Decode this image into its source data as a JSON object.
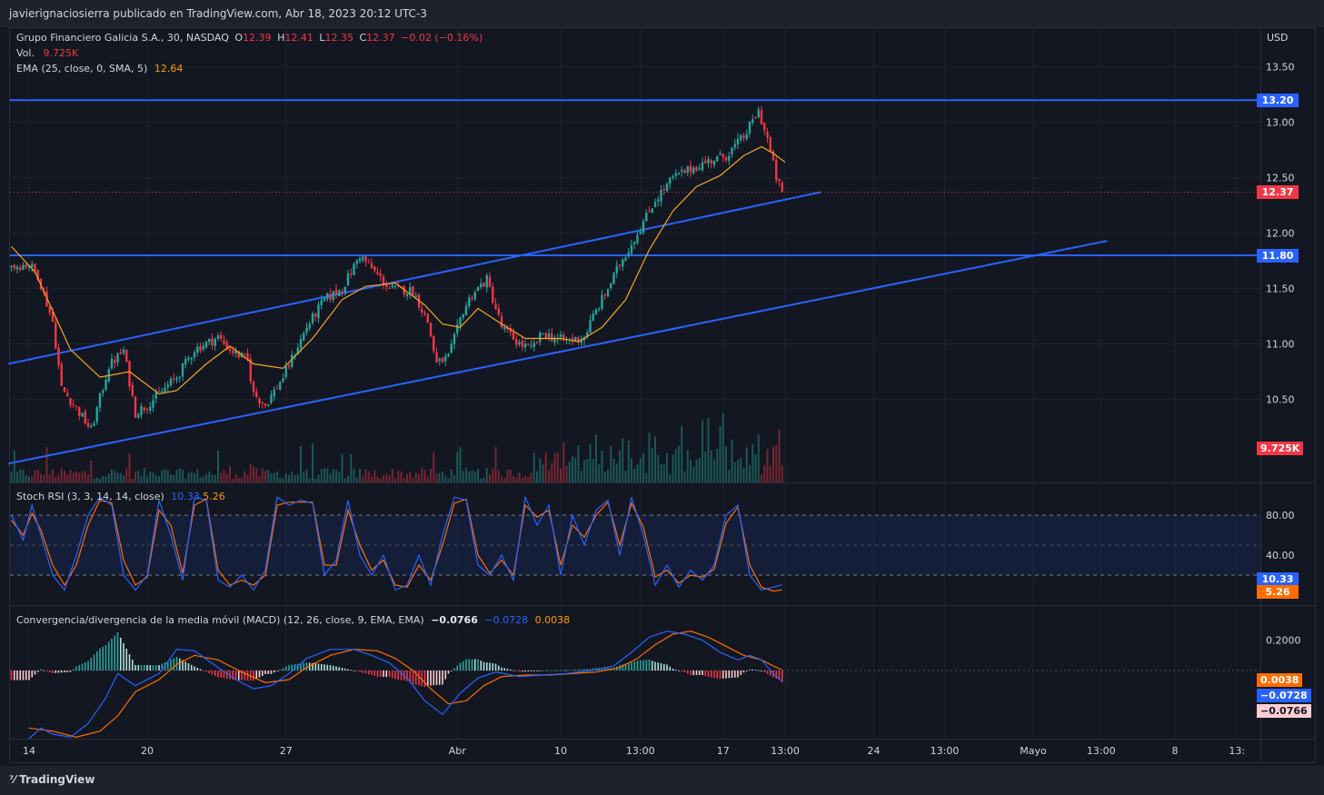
{
  "header": {
    "publisher": "javierignaciosierra publicado en TradingView.com, Abr 18, 2023 20:12 UTC-3"
  },
  "footer": {
    "logo": "TradingView"
  },
  "legend": {
    "symbol": "Grupo Financiero Galicia S.A., 30, NASDAQ",
    "o_label": "O",
    "o": "12.39",
    "h_label": "H",
    "h": "12.41",
    "l_label": "L",
    "l": "12.35",
    "c_label": "C",
    "c": "12.37",
    "change": "−0.02 (−0.16%)",
    "vol_label": "Vol.",
    "vol": "9.725K",
    "ema_label": "EMA (25, close, 0, SMA, 5)",
    "ema": "12.64",
    "stoch_label": "Stoch RSI (3, 3, 14, 14, close)",
    "stoch_k": "10.33",
    "stoch_d": "5.26",
    "macd_label": "Convergencia/divergencia de la media móvil (MACD) (12, 26, close, 9, EMA, EMA)",
    "macd_hist": "−0.0766",
    "macd": "−0.0728",
    "macd_signal": "0.0038"
  },
  "chart_data": {
    "type": "candlestick",
    "currency": "USD",
    "price_ticks": [
      "13.50",
      "13.00",
      "12.50",
      "12.00",
      "11.50",
      "11.00",
      "10.50"
    ],
    "price_tick_values": [
      13.5,
      13.0,
      12.5,
      12.0,
      11.5,
      11.0,
      10.5
    ],
    "price_range": [
      9.75,
      13.85
    ],
    "x_ticks": [
      "14",
      "20",
      "27",
      "Abr",
      "10",
      "13:00",
      "17",
      "13:00",
      "24",
      "13:00",
      "Mayo",
      "13:00",
      "8",
      "13:"
    ],
    "x_tick_slots": [
      6,
      46,
      93,
      151,
      186,
      213,
      241,
      262,
      292,
      316,
      346,
      369,
      394,
      415
    ],
    "last_slot": 261,
    "horizontal_levels": [
      {
        "value": 13.2,
        "label": "13.20"
      },
      {
        "value": 11.8,
        "label": "11.80"
      }
    ],
    "trendlines": [
      {
        "from": [
          -1,
          10.82
        ],
        "to": [
          274,
          12.37
        ]
      },
      {
        "from": [
          -1,
          9.92
        ],
        "to": [
          371,
          11.93
        ]
      }
    ],
    "last_price": {
      "value": 12.37,
      "label": "12.37"
    },
    "volume_badge": "9.725K",
    "price_path": [
      [
        0,
        11.7
      ],
      [
        6,
        11.72
      ],
      [
        9,
        11.62
      ],
      [
        14,
        11.2
      ],
      [
        17,
        10.6
      ],
      [
        22,
        10.42
      ],
      [
        27,
        10.22
      ],
      [
        33,
        10.8
      ],
      [
        38,
        10.94
      ],
      [
        42,
        10.38
      ],
      [
        46,
        10.45
      ],
      [
        50,
        10.55
      ],
      [
        56,
        10.7
      ],
      [
        62,
        10.95
      ],
      [
        70,
        11.06
      ],
      [
        74,
        10.95
      ],
      [
        80,
        10.85
      ],
      [
        82,
        10.55
      ],
      [
        86,
        10.45
      ],
      [
        92,
        10.7
      ],
      [
        100,
        11.15
      ],
      [
        106,
        11.4
      ],
      [
        112,
        11.5
      ],
      [
        118,
        11.8
      ],
      [
        124,
        11.62
      ],
      [
        128,
        11.5
      ],
      [
        136,
        11.48
      ],
      [
        141,
        11.2
      ],
      [
        144,
        10.82
      ],
      [
        148,
        10.88
      ],
      [
        153,
        11.3
      ],
      [
        156,
        11.45
      ],
      [
        161,
        11.58
      ],
      [
        166,
        11.15
      ],
      [
        172,
        11.0
      ],
      [
        176,
        10.95
      ],
      [
        180,
        11.1
      ],
      [
        184,
        11.05
      ],
      [
        188,
        11.03
      ],
      [
        194,
        11.06
      ],
      [
        197,
        11.25
      ],
      [
        202,
        11.5
      ],
      [
        206,
        11.72
      ],
      [
        212,
        12.0
      ],
      [
        218,
        12.3
      ],
      [
        224,
        12.5
      ],
      [
        230,
        12.58
      ],
      [
        236,
        12.65
      ],
      [
        242,
        12.7
      ],
      [
        248,
        12.87
      ],
      [
        253,
        13.1
      ],
      [
        256,
        12.85
      ],
      [
        259,
        12.5
      ],
      [
        261,
        12.37
      ]
    ],
    "ema_path": [
      [
        0,
        11.88
      ],
      [
        8,
        11.65
      ],
      [
        20,
        10.95
      ],
      [
        30,
        10.7
      ],
      [
        40,
        10.75
      ],
      [
        50,
        10.55
      ],
      [
        56,
        10.58
      ],
      [
        66,
        10.82
      ],
      [
        74,
        10.98
      ],
      [
        82,
        10.82
      ],
      [
        92,
        10.78
      ],
      [
        102,
        11.05
      ],
      [
        112,
        11.4
      ],
      [
        120,
        11.52
      ],
      [
        130,
        11.55
      ],
      [
        140,
        11.35
      ],
      [
        146,
        11.18
      ],
      [
        152,
        11.15
      ],
      [
        158,
        11.32
      ],
      [
        166,
        11.18
      ],
      [
        174,
        11.05
      ],
      [
        186,
        11.05
      ],
      [
        192,
        11.02
      ],
      [
        200,
        11.15
      ],
      [
        208,
        11.4
      ],
      [
        216,
        11.85
      ],
      [
        224,
        12.2
      ],
      [
        232,
        12.42
      ],
      [
        240,
        12.52
      ],
      [
        248,
        12.7
      ],
      [
        254,
        12.78
      ],
      [
        258,
        12.72
      ],
      [
        262,
        12.64
      ]
    ],
    "stoch_rsi": {
      "range": [
        0,
        100
      ],
      "ticks": [
        "80.00",
        "40.00"
      ],
      "tick_values": [
        80,
        40
      ],
      "bands": [
        80,
        50,
        20
      ],
      "k_last": 10.33,
      "d_last": 5.26,
      "k_path": [
        [
          0,
          80
        ],
        [
          4,
          55
        ],
        [
          7,
          90
        ],
        [
          10,
          60
        ],
        [
          14,
          20
        ],
        [
          18,
          5
        ],
        [
          22,
          40
        ],
        [
          26,
          80
        ],
        [
          30,
          98
        ],
        [
          34,
          90
        ],
        [
          38,
          20
        ],
        [
          42,
          5
        ],
        [
          46,
          20
        ],
        [
          50,
          95
        ],
        [
          54,
          60
        ],
        [
          58,
          15
        ],
        [
          62,
          98
        ],
        [
          66,
          95
        ],
        [
          70,
          15
        ],
        [
          74,
          8
        ],
        [
          78,
          20
        ],
        [
          82,
          5
        ],
        [
          86,
          25
        ],
        [
          90,
          98
        ],
        [
          94,
          90
        ],
        [
          98,
          95
        ],
        [
          102,
          92
        ],
        [
          106,
          20
        ],
        [
          110,
          35
        ],
        [
          114,
          95
        ],
        [
          118,
          40
        ],
        [
          122,
          20
        ],
        [
          126,
          40
        ],
        [
          130,
          5
        ],
        [
          134,
          10
        ],
        [
          138,
          40
        ],
        [
          142,
          10
        ],
        [
          146,
          60
        ],
        [
          150,
          98
        ],
        [
          154,
          95
        ],
        [
          158,
          30
        ],
        [
          162,
          20
        ],
        [
          166,
          40
        ],
        [
          170,
          15
        ],
        [
          174,
          98
        ],
        [
          178,
          70
        ],
        [
          182,
          90
        ],
        [
          186,
          20
        ],
        [
          190,
          80
        ],
        [
          194,
          50
        ],
        [
          198,
          85
        ],
        [
          202,
          95
        ],
        [
          206,
          40
        ],
        [
          210,
          98
        ],
        [
          214,
          60
        ],
        [
          218,
          10
        ],
        [
          222,
          30
        ],
        [
          226,
          8
        ],
        [
          230,
          25
        ],
        [
          234,
          15
        ],
        [
          238,
          30
        ],
        [
          242,
          80
        ],
        [
          246,
          90
        ],
        [
          250,
          20
        ],
        [
          254,
          5
        ],
        [
          258,
          8
        ],
        [
          261,
          10.33
        ]
      ],
      "d_path": [
        [
          0,
          75
        ],
        [
          4,
          60
        ],
        [
          7,
          82
        ],
        [
          10,
          65
        ],
        [
          14,
          30
        ],
        [
          18,
          10
        ],
        [
          22,
          30
        ],
        [
          26,
          70
        ],
        [
          30,
          95
        ],
        [
          34,
          92
        ],
        [
          38,
          35
        ],
        [
          42,
          10
        ],
        [
          46,
          18
        ],
        [
          50,
          85
        ],
        [
          54,
          70
        ],
        [
          58,
          22
        ],
        [
          62,
          90
        ],
        [
          66,
          96
        ],
        [
          70,
          25
        ],
        [
          74,
          10
        ],
        [
          78,
          15
        ],
        [
          82,
          10
        ],
        [
          86,
          20
        ],
        [
          90,
          90
        ],
        [
          94,
          93
        ],
        [
          98,
          93
        ],
        [
          102,
          93
        ],
        [
          106,
          30
        ],
        [
          110,
          30
        ],
        [
          114,
          85
        ],
        [
          118,
          50
        ],
        [
          122,
          25
        ],
        [
          126,
          35
        ],
        [
          130,
          10
        ],
        [
          134,
          8
        ],
        [
          138,
          30
        ],
        [
          142,
          15
        ],
        [
          146,
          50
        ],
        [
          150,
          92
        ],
        [
          154,
          96
        ],
        [
          158,
          40
        ],
        [
          162,
          22
        ],
        [
          166,
          35
        ],
        [
          170,
          20
        ],
        [
          174,
          90
        ],
        [
          178,
          78
        ],
        [
          182,
          85
        ],
        [
          186,
          30
        ],
        [
          190,
          70
        ],
        [
          194,
          58
        ],
        [
          198,
          80
        ],
        [
          202,
          93
        ],
        [
          206,
          50
        ],
        [
          210,
          92
        ],
        [
          214,
          68
        ],
        [
          218,
          18
        ],
        [
          222,
          25
        ],
        [
          226,
          12
        ],
        [
          230,
          20
        ],
        [
          234,
          18
        ],
        [
          238,
          26
        ],
        [
          242,
          72
        ],
        [
          246,
          88
        ],
        [
          250,
          30
        ],
        [
          254,
          8
        ],
        [
          258,
          4
        ],
        [
          261,
          5.26
        ]
      ]
    },
    "macd": {
      "range": [
        -0.45,
        0.33
      ],
      "ticks": [
        "0.2000"
      ],
      "tick_values": [
        0.2
      ],
      "hist_last": -0.0766,
      "macd_last": -0.0728,
      "signal_last": 0.0038,
      "macd_path": [
        [
          6,
          -0.45
        ],
        [
          10,
          -0.38
        ],
        [
          14,
          -0.42
        ],
        [
          20,
          -0.44
        ],
        [
          26,
          -0.35
        ],
        [
          32,
          -0.18
        ],
        [
          36,
          -0.02
        ],
        [
          42,
          -0.1
        ],
        [
          50,
          -0.02
        ],
        [
          56,
          0.14
        ],
        [
          62,
          0.13
        ],
        [
          70,
          0.02
        ],
        [
          76,
          -0.06
        ],
        [
          82,
          -0.12
        ],
        [
          88,
          -0.1
        ],
        [
          94,
          -0.02
        ],
        [
          100,
          0.08
        ],
        [
          108,
          0.14
        ],
        [
          116,
          0.14
        ],
        [
          122,
          0.1
        ],
        [
          128,
          0.05
        ],
        [
          134,
          -0.05
        ],
        [
          140,
          -0.2
        ],
        [
          146,
          -0.29
        ],
        [
          152,
          -0.15
        ],
        [
          158,
          -0.05
        ],
        [
          164,
          -0.01
        ],
        [
          172,
          -0.04
        ],
        [
          180,
          -0.03
        ],
        [
          188,
          -0.02
        ],
        [
          196,
          0.0
        ],
        [
          204,
          0.03
        ],
        [
          210,
          0.12
        ],
        [
          216,
          0.22
        ],
        [
          222,
          0.26
        ],
        [
          228,
          0.24
        ],
        [
          234,
          0.2
        ],
        [
          240,
          0.12
        ],
        [
          246,
          0.07
        ],
        [
          250,
          0.1
        ],
        [
          254,
          0.07
        ],
        [
          258,
          -0.02
        ],
        [
          261,
          -0.0728
        ]
      ],
      "signal_path": [
        [
          6,
          -0.38
        ],
        [
          14,
          -0.4
        ],
        [
          22,
          -0.44
        ],
        [
          30,
          -0.4
        ],
        [
          36,
          -0.3
        ],
        [
          42,
          -0.14
        ],
        [
          50,
          -0.06
        ],
        [
          56,
          0.04
        ],
        [
          62,
          0.1
        ],
        [
          70,
          0.07
        ],
        [
          78,
          -0.01
        ],
        [
          86,
          -0.08
        ],
        [
          94,
          -0.06
        ],
        [
          100,
          0.02
        ],
        [
          108,
          0.1
        ],
        [
          116,
          0.14
        ],
        [
          124,
          0.13
        ],
        [
          130,
          0.08
        ],
        [
          136,
          0.0
        ],
        [
          142,
          -0.12
        ],
        [
          148,
          -0.22
        ],
        [
          154,
          -0.2
        ],
        [
          160,
          -0.1
        ],
        [
          166,
          -0.04
        ],
        [
          174,
          -0.03
        ],
        [
          182,
          -0.03
        ],
        [
          190,
          -0.02
        ],
        [
          198,
          -0.01
        ],
        [
          206,
          0.02
        ],
        [
          212,
          0.08
        ],
        [
          218,
          0.17
        ],
        [
          224,
          0.24
        ],
        [
          230,
          0.26
        ],
        [
          236,
          0.22
        ],
        [
          242,
          0.16
        ],
        [
          248,
          0.1
        ],
        [
          254,
          0.07
        ],
        [
          258,
          0.03
        ],
        [
          261,
          0.0038
        ]
      ]
    }
  },
  "colors": {
    "up": "#26a69a",
    "down": "#f23645",
    "level": "#2962ff",
    "ema": "#f5a623",
    "stoch_k": "#2962ff",
    "stoch_d": "#ff6d00",
    "macd": "#2962ff",
    "signal": "#ff6d00",
    "grid": "#1e222d",
    "axis_text": "#d1d4dc",
    "background": "#131722"
  }
}
